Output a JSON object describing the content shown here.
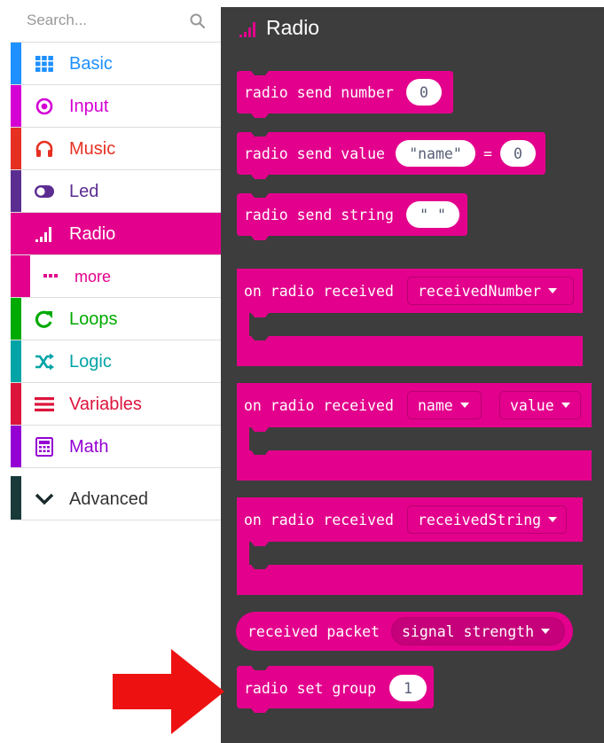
{
  "search": {
    "placeholder": "Search..."
  },
  "categories": [
    {
      "label": "Basic",
      "color": "#1e90ff",
      "icon": "grid-icon"
    },
    {
      "label": "Input",
      "color": "#d400d4",
      "icon": "target-icon"
    },
    {
      "label": "Music",
      "color": "#e63022",
      "icon": "headphones-icon"
    },
    {
      "label": "Led",
      "color": "#5c2d91",
      "icon": "toggle-icon"
    },
    {
      "label": "Radio",
      "color": "#e3008c",
      "icon": "signal-bars-icon",
      "active": true
    },
    {
      "label": "more",
      "color": "#e3008c",
      "icon": "ellipsis-icon"
    },
    {
      "label": "Loops",
      "color": "#00aa00",
      "icon": "loop-icon"
    },
    {
      "label": "Logic",
      "color": "#00a4a6",
      "icon": "shuffle-icon"
    },
    {
      "label": "Variables",
      "color": "#dc143c",
      "icon": "list-icon"
    },
    {
      "label": "Math",
      "color": "#9400d3",
      "icon": "calculator-icon"
    },
    {
      "label": "Advanced",
      "color": "#1a3a3a",
      "icon": "chevron-down-icon"
    }
  ],
  "flyout": {
    "title": "Radio",
    "block_color": "#e3008c",
    "blocks": {
      "send_number": {
        "text": "radio send number",
        "value": "0"
      },
      "send_value": {
        "text": "radio send value",
        "name_value": "\"name\"",
        "equals": "=",
        "value": "0"
      },
      "send_string": {
        "text": "radio send string",
        "value": "\" \""
      },
      "on_received_number": {
        "text": "on radio received",
        "param": "receivedNumber"
      },
      "on_received_value": {
        "text": "on radio received",
        "param1": "name",
        "param2": "value"
      },
      "on_received_string": {
        "text": "on radio received",
        "param": "receivedString"
      },
      "received_packet": {
        "text": "received packet",
        "property": "signal strength"
      },
      "set_group": {
        "text": "radio set group",
        "value": "1"
      }
    }
  },
  "annotation": {
    "arrow_color": "#ee1111"
  }
}
